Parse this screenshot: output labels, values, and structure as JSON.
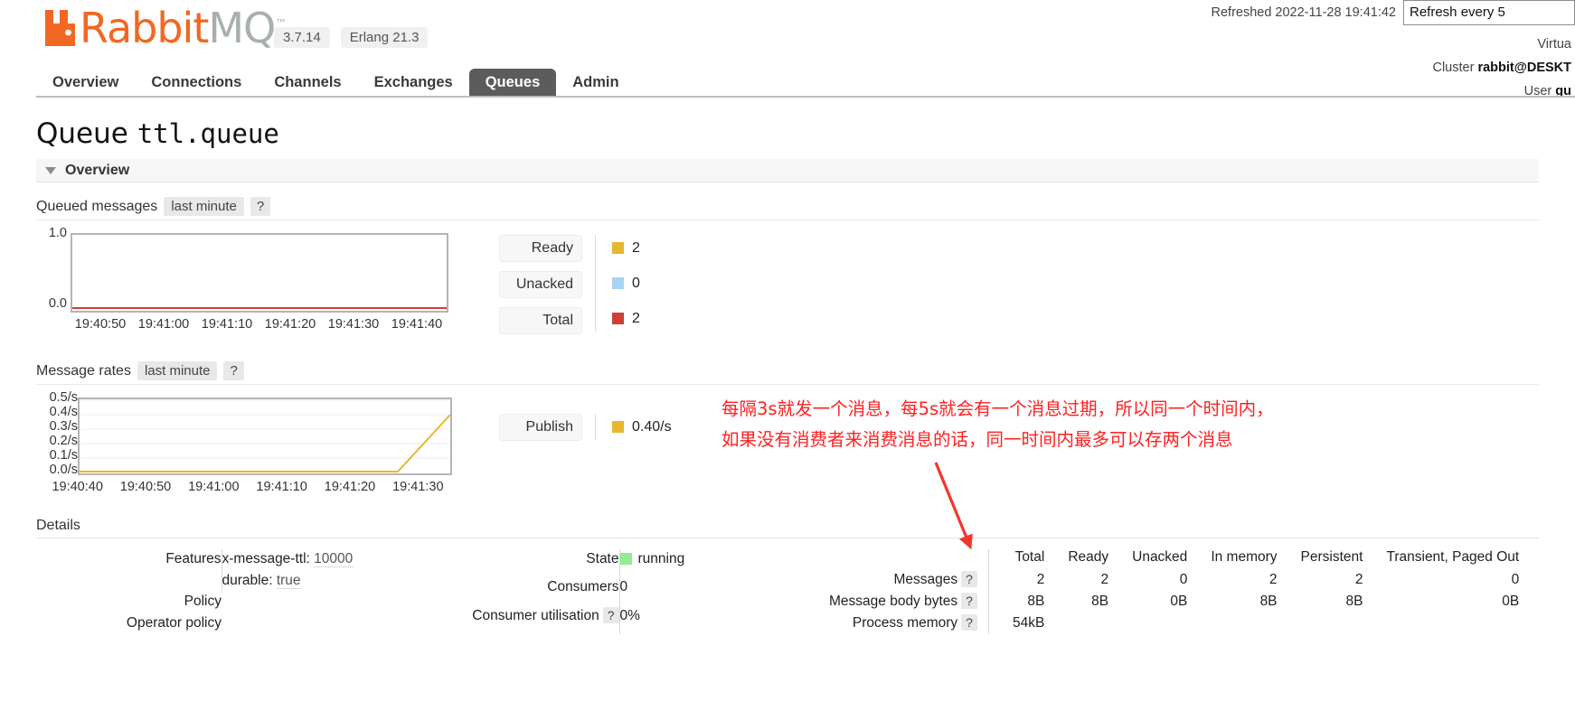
{
  "header": {
    "logo_rabbit": "Rabbit",
    "logo_mq": "MQ",
    "logo_tm": "™",
    "version_badge": "3.7.14",
    "erlang_badge": "Erlang 21.3",
    "refreshed_label": "Refreshed 2022-11-28 19:41:42",
    "refresh_select_value": "Refresh every 5",
    "virtual_host_label": "Virtua",
    "cluster_label": "Cluster",
    "cluster_value": "rabbit@DESKT",
    "user_label": "User",
    "user_value": "gu"
  },
  "nav": {
    "tabs": [
      {
        "label": "Overview",
        "active": false
      },
      {
        "label": "Connections",
        "active": false
      },
      {
        "label": "Channels",
        "active": false
      },
      {
        "label": "Exchanges",
        "active": false
      },
      {
        "label": "Queues",
        "active": true
      },
      {
        "label": "Admin",
        "active": false
      }
    ]
  },
  "page": {
    "title_prefix": "Queue",
    "title_name": "ttl.queue",
    "overview_section": "Overview",
    "details_section": "Details"
  },
  "queued_messages": {
    "label": "Queued messages",
    "period": "last minute",
    "help": "?",
    "legend": [
      {
        "name": "Ready",
        "value": "2",
        "color": "#e8b730"
      },
      {
        "name": "Unacked",
        "value": "0",
        "color": "#a6d4f2"
      },
      {
        "name": "Total",
        "value": "2",
        "color": "#cf3f35"
      }
    ]
  },
  "message_rates": {
    "label": "Message rates",
    "period": "last minute",
    "help": "?",
    "legend": [
      {
        "name": "Publish",
        "value": "0.40/s",
        "color": "#e8b730"
      }
    ]
  },
  "annotation": {
    "line1": "每隔3s就发一个消息，每5s就会有一个消息过期，所以同一个时间内，",
    "line2": "如果没有消费者来消费消息的话，同一时间内最多可以存两个消息",
    "color": "#ff2020"
  },
  "details": {
    "left_rows": [
      {
        "key": "Features",
        "arg_name": "x-message-ttl:",
        "arg_value": "10000"
      },
      {
        "key": "",
        "arg_name": "durable:",
        "arg_value": "true"
      },
      {
        "key": "Policy",
        "arg_name": "",
        "arg_value": ""
      },
      {
        "key": "Operator policy",
        "arg_name": "",
        "arg_value": ""
      }
    ],
    "middle_rows": [
      {
        "key": "State",
        "value": "running",
        "has_dot": true,
        "help": false
      },
      {
        "key": "Consumers",
        "value": "0",
        "has_dot": false,
        "help": false
      },
      {
        "key": "Consumer utilisation",
        "value": "0%",
        "has_dot": false,
        "help": true
      }
    ],
    "help_mark": "?"
  },
  "stats_table": {
    "columns": [
      "Total",
      "Ready",
      "Unacked",
      "In memory",
      "Persistent",
      "Transient, Paged Out"
    ],
    "rows": [
      {
        "label": "Messages",
        "help": "?",
        "values": [
          "2",
          "2",
          "0",
          "2",
          "2",
          "0"
        ]
      },
      {
        "label": "Message body bytes",
        "help": "?",
        "values": [
          "8B",
          "8B",
          "0B",
          "8B",
          "8B",
          "0B"
        ]
      },
      {
        "label": "Process memory",
        "help": "?",
        "values": [
          "54kB",
          "",
          "",
          "",
          "",
          ""
        ]
      }
    ]
  },
  "chart_data": [
    {
      "type": "line",
      "title": "Queued messages",
      "subtitle": "last minute",
      "xlabel": "",
      "ylabel": "",
      "ylim": [
        0.0,
        1.0
      ],
      "yticks": [
        "0.0",
        "1.0"
      ],
      "xticks": [
        "19:40:50",
        "19:41:00",
        "19:41:10",
        "19:41:20",
        "19:41:30",
        "19:41:40"
      ],
      "grid": false,
      "legend_position": "right",
      "series": [
        {
          "name": "Ready",
          "color": "#e8b730",
          "current": 2,
          "values": [
            2,
            2,
            2,
            2,
            2,
            2
          ]
        },
        {
          "name": "Unacked",
          "color": "#a6d4f2",
          "current": 0,
          "values": [
            0,
            0,
            0,
            0,
            0,
            0
          ]
        },
        {
          "name": "Total",
          "color": "#cf3f35",
          "current": 2,
          "values": [
            2,
            2,
            2,
            2,
            2,
            2
          ]
        }
      ]
    },
    {
      "type": "line",
      "title": "Message rates",
      "subtitle": "last minute",
      "xlabel": "",
      "ylabel": "",
      "ylim": [
        0.0,
        0.5
      ],
      "yticks": [
        "0.5/s",
        "0.4/s",
        "0.3/s",
        "0.2/s",
        "0.1/s",
        "0.0/s"
      ],
      "xticks": [
        "19:40:40",
        "19:40:50",
        "19:41:00",
        "19:41:10",
        "19:41:20",
        "19:41:30"
      ],
      "grid": true,
      "legend_position": "right",
      "series": [
        {
          "name": "Publish",
          "color": "#e8b730",
          "current": 0.4,
          "values": [
            0.0,
            0.0,
            0.0,
            0.0,
            0.0,
            0.4
          ]
        }
      ]
    }
  ]
}
